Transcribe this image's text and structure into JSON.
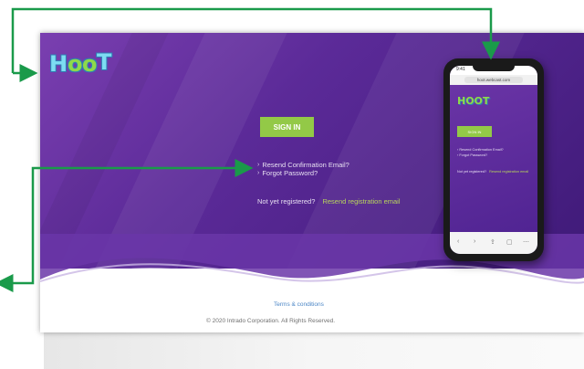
{
  "app": {
    "logo_text": "HOOT"
  },
  "login": {
    "signin_label": "SIGN IN",
    "resend_confirmation": "Resend Confirmation Email?",
    "forgot_password": "Forgot Password?",
    "not_registered": "Not yet registered?",
    "resend_registration": "Resend registration email"
  },
  "footer": {
    "terms": "Terms & conditions",
    "copyright": "© 2020 Intrado Corporation. All Rights Reserved."
  },
  "phone": {
    "time": "9:41",
    "url": "hoot.webcast.com",
    "signin_label": "SIGN IN",
    "line1": "› Resend Confirmation Email?",
    "line2": "› Forgot Password?",
    "line3a": "Not yet registered?",
    "line3b": "Resend registration email"
  },
  "colors": {
    "hero_purple": "#5b2a98",
    "accent_green": "#93c947",
    "arrow_green": "#1a9a4a",
    "link_blue": "#4b86c6"
  },
  "icons": {
    "chevron": "chevron-right-icon"
  }
}
